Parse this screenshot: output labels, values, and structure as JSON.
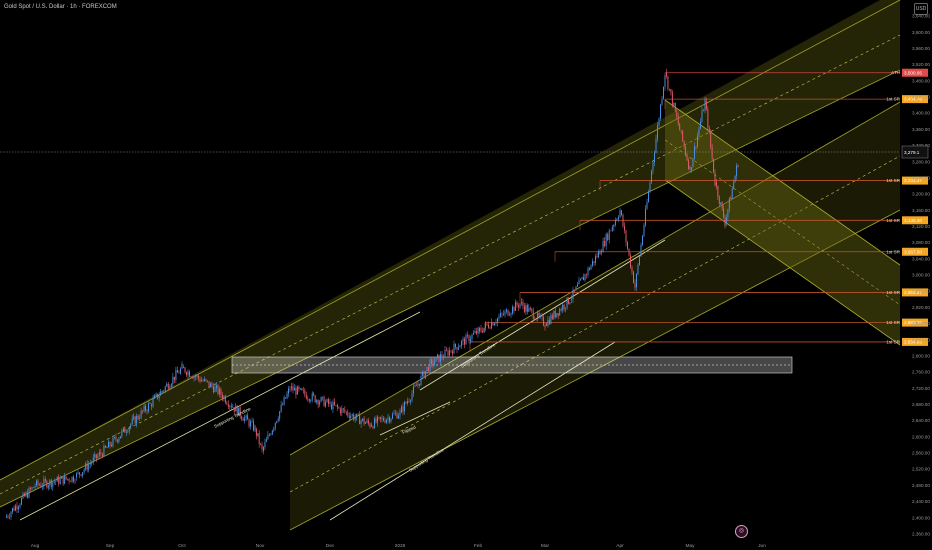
{
  "header": {
    "title": "Gold Spot / U.S. Dollar · 1h · FOREXCOM",
    "currency": "USD"
  },
  "chart_data": {
    "type": "candlestick",
    "title": "Gold Spot / U.S. Dollar · 1h · FOREXCOM",
    "x_ticks": [
      "Aug",
      "Sep",
      "Oct",
      "Nov",
      "Dec",
      "2025",
      "Feb",
      "Mar",
      "Apr",
      "May",
      "Jun"
    ],
    "y_ticks": [
      2360,
      2400,
      2440,
      2480,
      2520,
      2560,
      2600,
      2640,
      2680,
      2720,
      2760,
      2800,
      2840,
      2880,
      2920,
      2960,
      3000,
      3040,
      3080,
      3120,
      3160,
      3200,
      3240,
      3280,
      3320,
      3360,
      3400,
      3440,
      3480,
      3520,
      3560,
      3600,
      3640
    ],
    "ylim": [
      2345,
      3665
    ],
    "current_price_label": "3,279.1",
    "levels": [
      {
        "label": "ATH",
        "price": 3500.05,
        "tag": "3,500.05",
        "tag_color": "#e04a4a"
      },
      {
        "label": "1st SR",
        "price": 3434.78,
        "tag": "3,434.78",
        "tag_color": "#f5a623"
      },
      {
        "label": "1st SR",
        "price": 3233.47,
        "tag": "3,233.47",
        "tag_color": "#f5a623"
      },
      {
        "label": "1st SR",
        "price": 3135.3,
        "tag": "3,135.30",
        "tag_color": "#f5a623"
      },
      {
        "label": "1st SR",
        "price": 3057.5,
        "tag": "3,057.50",
        "tag_color": "#f5a623"
      },
      {
        "label": "1st SR",
        "price": 2956.97,
        "tag": "2,956.97",
        "tag_color": "#f5a623"
      },
      {
        "label": "1st SR",
        "price": 2882.36,
        "tag": "2,882.36",
        "tag_color": "#f5a623"
      },
      {
        "label": "1st SR",
        "price": 2834.63,
        "tag": "2,834.63",
        "tag_color": "#f5a623"
      }
    ],
    "annotations": [
      "Supporting Trendline",
      "Supporting Trendline",
      "Supporting Trendline",
      "Flipped",
      "Supporting Trendline"
    ],
    "price_path_keypoints": [
      [
        "Aug",
        2400
      ],
      [
        "Aug",
        2480
      ],
      [
        "Sep",
        2500
      ],
      [
        "Sep",
        2580
      ],
      [
        "Oct",
        2680
      ],
      [
        "Oct",
        2770
      ],
      [
        "Oct",
        2720
      ],
      [
        "Nov",
        2620
      ],
      [
        "Nov",
        2565
      ],
      [
        "Nov",
        2720
      ],
      [
        "Dec",
        2680
      ],
      [
        "Dec",
        2630
      ],
      [
        "2025",
        2660
      ],
      [
        "2025",
        2780
      ],
      [
        "Feb",
        2860
      ],
      [
        "Feb",
        2930
      ],
      [
        "Mar",
        2880
      ],
      [
        "Mar",
        2940
      ],
      [
        "Mar",
        3060
      ],
      [
        "Apr",
        3160
      ],
      [
        "Apr",
        2970
      ],
      [
        "Apr",
        3230
      ],
      [
        "Apr",
        3500
      ],
      [
        "Apr",
        3260
      ],
      [
        "May",
        3430
      ],
      [
        "May",
        3230
      ],
      [
        "May",
        3130
      ],
      [
        "May",
        3279
      ]
    ],
    "colors": {
      "up": "#4a8fe0",
      "down": "#e05a6a",
      "channel_fill": "#6b6b10",
      "channel_line": "#9a9a25",
      "level_line": "#c0522a",
      "zone_fill": "#ffffff"
    }
  },
  "logo_icon": "tradingview-logo-icon"
}
